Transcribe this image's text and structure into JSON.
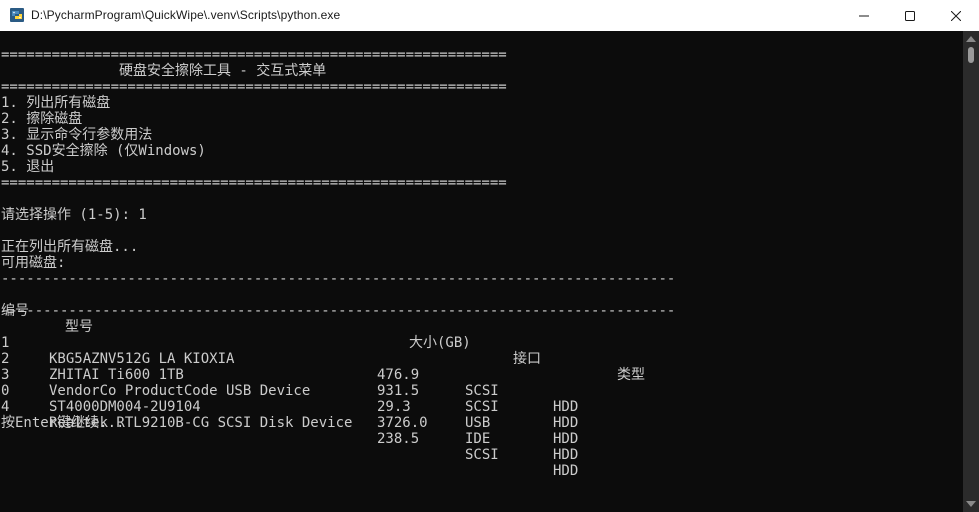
{
  "window": {
    "title": "D:\\PycharmProgram\\QuickWipe\\.venv\\Scripts\\python.exe",
    "icon": "python-icon",
    "controls": [
      "minimize-icon",
      "maximize-icon",
      "close-icon"
    ]
  },
  "console": {
    "separator": "============================================================",
    "menu_title": "              硬盘安全擦除工具 - 交互式菜单",
    "menu_items": [
      "1. 列出所有磁盘",
      "2. 擦除磁盘",
      "3. 显示命令行参数用法",
      "4. SSD安全擦除 (仅Windows)",
      "5. 退出"
    ],
    "prompt": "请选择操作 (1-5): 1",
    "listing_msg": "正在列出所有磁盘...",
    "available_label": "可用磁盘:",
    "dash_line": "--------------------------------------------------------------------------------",
    "headers": {
      "id": "编号",
      "model": "型号",
      "size": "大小(GB)",
      "interface": "接口",
      "type": "类型"
    },
    "disks": [
      {
        "id": "1",
        "model": "KBG5AZNV512G LA KIOXIA",
        "size": "476.9",
        "interface": "SCSI",
        "type": "HDD"
      },
      {
        "id": "2",
        "model": "ZHITAI Ti600 1TB",
        "size": "931.5",
        "interface": "SCSI",
        "type": "HDD"
      },
      {
        "id": "3",
        "model": "VendorCo ProductCode USB Device",
        "size": "29.3",
        "interface": "USB",
        "type": "HDD"
      },
      {
        "id": "0",
        "model": "ST4000DM004-2U9104",
        "size": "3726.0",
        "interface": "IDE",
        "type": "HDD"
      },
      {
        "id": "4",
        "model": "Realtek RTL9210B-CG SCSI Disk Device",
        "size": "238.5",
        "interface": "SCSI",
        "type": "HDD"
      }
    ],
    "continue_prompt": "按Enter键继续..."
  },
  "colors": {
    "console_bg": "#0c0c0c",
    "console_fg": "#cccccc",
    "titlebar_bg": "#ffffff"
  }
}
